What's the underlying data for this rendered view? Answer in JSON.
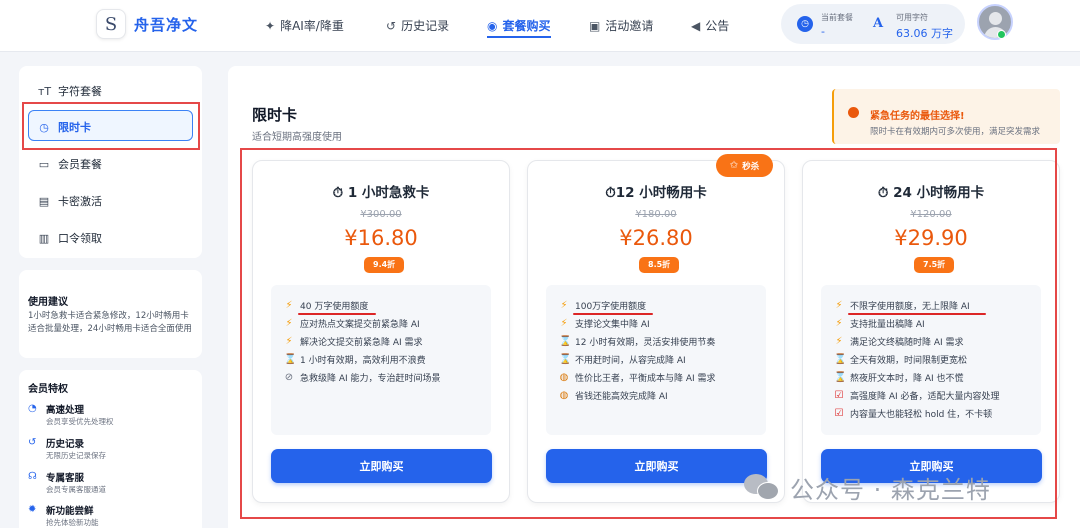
{
  "header": {
    "logo_letter": "S",
    "brand": "舟吾净文",
    "nav": [
      {
        "label": "降AI率/降重",
        "icon": "magic-wand-icon"
      },
      {
        "label": "历史记录",
        "icon": "history-icon"
      },
      {
        "label": "套餐购买",
        "icon": "user-badge-icon",
        "active": true
      },
      {
        "label": "活动邀请",
        "icon": "briefcase-icon"
      },
      {
        "label": "公告",
        "icon": "megaphone-icon"
      }
    ],
    "status": {
      "plan_label": "当前套餐",
      "plan_value": "-",
      "chars_icon": "A",
      "chars_label": "可用字符",
      "chars_value": "63.06 万字"
    }
  },
  "sidebar": {
    "menu": [
      {
        "label": "字符套餐",
        "icon": "font-size-icon"
      },
      {
        "label": "限时卡",
        "icon": "clock-icon",
        "active": true
      },
      {
        "label": "会员套餐",
        "icon": "monitor-icon"
      },
      {
        "label": "卡密激活",
        "icon": "card-icon"
      },
      {
        "label": "口令领取",
        "icon": "gift-icon"
      }
    ],
    "tips": {
      "title": "使用建议",
      "text": "1小时急救卡适合紧急修改，12小时畅用卡适合批量处理，24小时畅用卡适合全面使用"
    },
    "privileges": {
      "title": "会员特权",
      "items": [
        {
          "title": "高速处理",
          "desc": "会员享受优先处理权",
          "icon": "speedometer-icon"
        },
        {
          "title": "历史记录",
          "desc": "无限历史记录保存",
          "icon": "history-icon"
        },
        {
          "title": "专属客服",
          "desc": "会员专属客服通道",
          "icon": "headset-icon"
        },
        {
          "title": "新功能尝鲜",
          "desc": "抢先体验新功能",
          "icon": "gear-icon"
        }
      ]
    }
  },
  "main": {
    "title": "限时卡",
    "subtitle": "适合短期高强度使用",
    "promo": {
      "title": "紧急任务的最佳选择!",
      "desc": "限时卡在有效期内可多次使用，满足突发需求"
    },
    "flash_badge": "秒杀",
    "buy_label": "立即购买",
    "plans": [
      {
        "title": "1 小时急救卡",
        "old_price": "¥300.00",
        "price": "¥16.80",
        "discount": "9.4折",
        "features": [
          {
            "icon": "bolt",
            "text": "40 万字使用额度"
          },
          {
            "icon": "bolt",
            "text": "应对热点文案提交前紧急降 AI"
          },
          {
            "icon": "bolt",
            "text": "解决论文提交前紧急降 AI 需求"
          },
          {
            "icon": "hourglass",
            "text": "1 小时有效期，高效利用不浪费"
          },
          {
            "icon": "ban",
            "text": "急救级降 AI 能力，专治赶时间场景"
          }
        ]
      },
      {
        "title": "12 小时畅用卡",
        "old_price": "¥180.00",
        "price": "¥26.80",
        "discount": "8.5折",
        "features": [
          {
            "icon": "bolt",
            "text": "100万字使用额度"
          },
          {
            "icon": "bolt",
            "text": "支撑论文集中降 AI"
          },
          {
            "icon": "hourglass",
            "text": "12 小时有效期，灵活安排使用节奏"
          },
          {
            "icon": "hourglass",
            "text": "不用赶时间，从容完成降 AI"
          },
          {
            "icon": "money-bag",
            "text": "性价比王者，平衡成本与降 AI 需求"
          },
          {
            "icon": "money-bag",
            "text": "省钱还能高效完成降 AI"
          }
        ]
      },
      {
        "title": "24 小时畅用卡",
        "old_price": "¥120.00",
        "price": "¥29.90",
        "discount": "7.5折",
        "features": [
          {
            "icon": "bolt",
            "text": "不限字使用额度，无上限降 AI"
          },
          {
            "icon": "bolt",
            "text": "支持批量出稿降 AI"
          },
          {
            "icon": "bolt",
            "text": "满足论文终稿随时降 AI 需求"
          },
          {
            "icon": "hourglass",
            "text": "全天有效期，时间限制更宽松"
          },
          {
            "icon": "hourglass",
            "text": "熬夜肝文本时，降 AI 也不慌"
          },
          {
            "icon": "checkbox",
            "text": "高强度降 AI 必备，适配大量内容处理"
          },
          {
            "icon": "checkbox",
            "text": "内容量大也能轻松 hold 住，不卡顿"
          }
        ]
      }
    ]
  },
  "watermark": "公众号 · 森克兰特"
}
